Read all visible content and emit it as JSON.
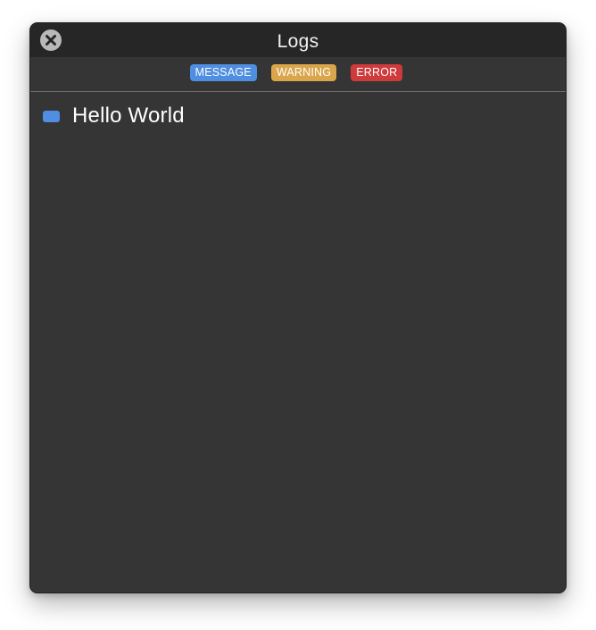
{
  "window": {
    "title": "Logs",
    "close_icon": "close-icon"
  },
  "filters": [
    {
      "label": "MESSAGE",
      "color": "#4f8ee0"
    },
    {
      "label": "WARNING",
      "color": "#dba64b"
    },
    {
      "label": "ERROR",
      "color": "#cf3a3a"
    }
  ],
  "logs": [
    {
      "level": "message",
      "text": "Hello World",
      "color": "#4f8ee0"
    }
  ]
}
